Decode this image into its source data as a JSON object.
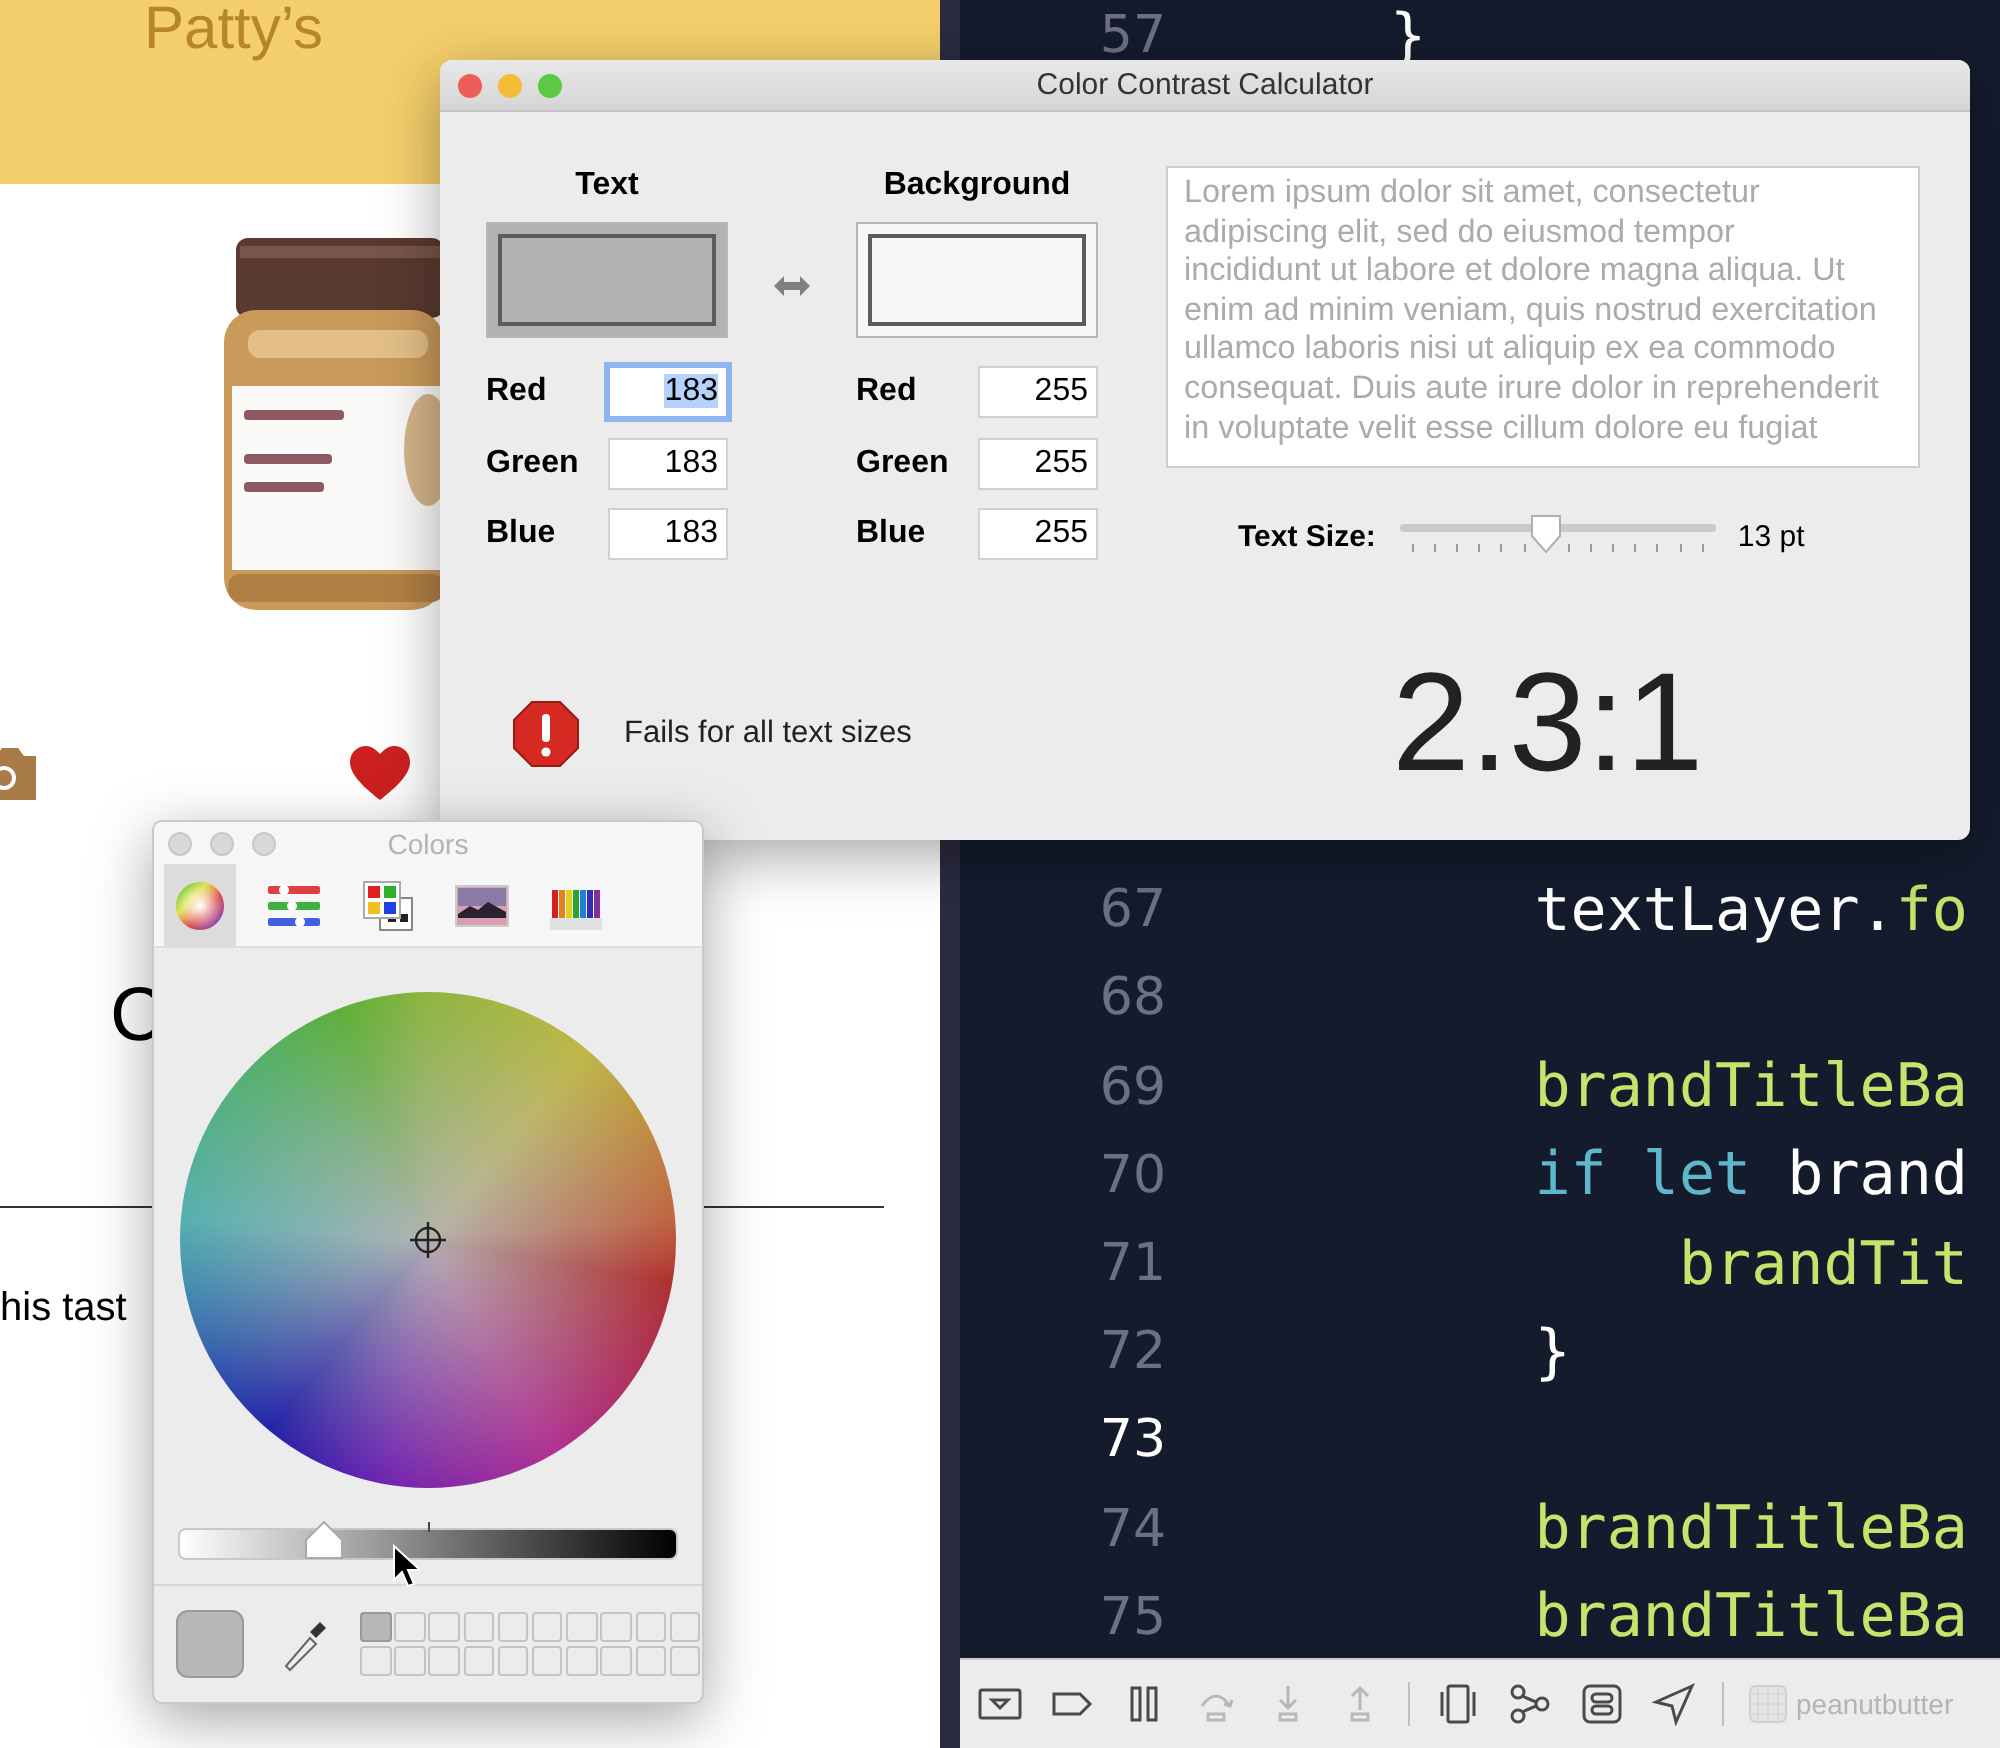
{
  "background_app": {
    "header_title": "Patty’s",
    "heading_fragment": "C",
    "body_fragment": "his tast"
  },
  "code_editor": {
    "top_lines": [
      {
        "number": "57",
        "current": false,
        "tokens": [
          {
            "kind": "plain",
            "text": "}"
          }
        ]
      }
    ],
    "lines": [
      {
        "number": "67",
        "current": false,
        "tokens": [
          {
            "kind": "plain",
            "text": "    textLayer."
          },
          {
            "kind": "call",
            "text": "fo"
          }
        ]
      },
      {
        "number": "68",
        "current": false
      },
      {
        "number": "69",
        "current": false,
        "tokens": [
          {
            "kind": "call",
            "text": "    brandTitleBa"
          }
        ]
      },
      {
        "number": "70",
        "current": false,
        "tokens": [
          {
            "kind": "keyword",
            "text": "    if let"
          },
          {
            "kind": "plain",
            "text": " brand"
          }
        ]
      },
      {
        "number": "71",
        "current": false,
        "tokens": [
          {
            "kind": "call",
            "text": "        brandTit"
          }
        ]
      },
      {
        "number": "72",
        "current": false,
        "tokens": [
          {
            "kind": "plain",
            "text": "    }"
          }
        ]
      },
      {
        "number": "73",
        "current": true
      },
      {
        "number": "74",
        "current": false,
        "tokens": [
          {
            "kind": "call",
            "text": "    brandTitleBa"
          }
        ]
      },
      {
        "number": "75",
        "current": false,
        "tokens": [
          {
            "kind": "call",
            "text": "    brandTitleBa"
          }
        ]
      }
    ],
    "toolbar": {
      "items": [
        {
          "kind": "console",
          "disabled": false
        },
        {
          "kind": "breakpoints",
          "disabled": false
        },
        {
          "kind": "pause",
          "disabled": false
        },
        {
          "kind": "step-over",
          "disabled": true
        },
        {
          "kind": "step-in",
          "disabled": true
        },
        {
          "kind": "step-out",
          "disabled": true
        },
        {
          "kind": "separator"
        },
        {
          "kind": "view-debugger",
          "disabled": false
        },
        {
          "kind": "memory-graph",
          "disabled": false
        },
        {
          "kind": "environment",
          "disabled": false
        },
        {
          "kind": "location",
          "disabled": false
        },
        {
          "kind": "separator"
        }
      ],
      "scheme": "peanutbutter"
    }
  },
  "contrast_window": {
    "title": "Color Contrast Calculator",
    "active": true,
    "columns": [
      {
        "heading": "Text",
        "fields": [
          {
            "label": "Red",
            "value": "183",
            "focused": true
          },
          {
            "label": "Green",
            "value": "183",
            "focused": false
          },
          {
            "label": "Blue",
            "value": "183",
            "focused": false
          }
        ]
      },
      {
        "heading": "Background",
        "fields": [
          {
            "label": "Red",
            "value": "255",
            "focused": false
          },
          {
            "label": "Green",
            "value": "255",
            "focused": false
          },
          {
            "label": "Blue",
            "value": "255",
            "focused": false
          }
        ]
      }
    ],
    "sample_lines": [
      "Lorem ipsum dolor sit amet, consectetur",
      "adipiscing elit, sed do eiusmod tempor",
      "incididunt ut labore et dolore magna aliqua. Ut",
      "enim ad minim veniam, quis nostrud exercitation",
      "ullamco laboris nisi ut aliquip ex ea commodo",
      "consequat. Duis aute irure dolor in reprehenderit",
      "in voluptate velit esse cillum dolore eu fugiat"
    ],
    "text_size": {
      "label": "Text Size:",
      "level": 0.46,
      "reading": "13 pt"
    },
    "result": {
      "kind": "fail",
      "message": "Fails for all text sizes",
      "ratio": "2.3:1"
    }
  },
  "colors_panel": {
    "title": "Colors",
    "active": false,
    "tabs": [
      {
        "kind": "wheel",
        "selected": true
      },
      {
        "kind": "sliders",
        "selected": false
      },
      {
        "kind": "palettes",
        "selected": false
      },
      {
        "kind": "images",
        "selected": false
      },
      {
        "kind": "pencils",
        "selected": false
      }
    ],
    "brightness": {
      "level": 0.29
    },
    "swatches": [
      {
        "filled": true,
        "color": "#b7b7b7"
      },
      {
        "filled": false
      },
      {
        "filled": false
      },
      {
        "filled": false
      },
      {
        "filled": false
      },
      {
        "filled": false
      },
      {
        "filled": false
      },
      {
        "filled": false
      },
      {
        "filled": false
      },
      {
        "filled": false
      },
      {
        "filled": false
      },
      {
        "filled": false
      },
      {
        "filled": false
      },
      {
        "filled": false
      },
      {
        "filled": false
      },
      {
        "filled": false
      },
      {
        "filled": false
      },
      {
        "filled": false
      },
      {
        "filled": false
      },
      {
        "filled": false
      }
    ]
  }
}
